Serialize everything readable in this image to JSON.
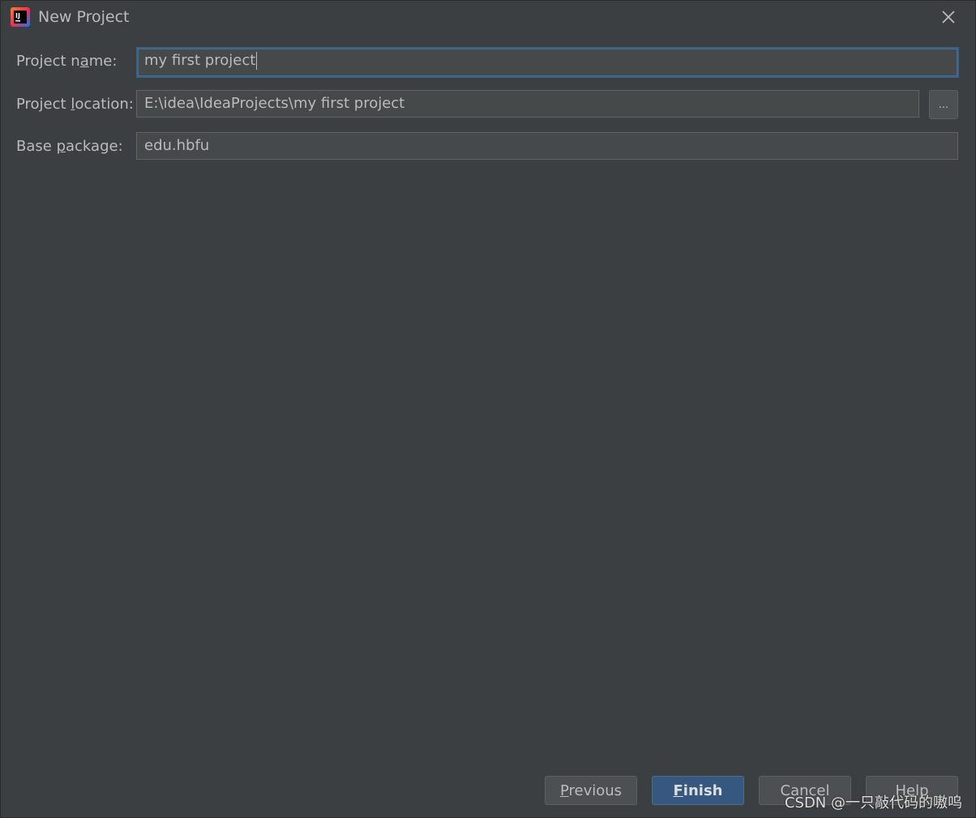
{
  "window": {
    "title": "New Project",
    "icon": "intellij-idea-icon",
    "close_icon": "close-icon"
  },
  "form": {
    "project_name": {
      "label_pre": "Project n",
      "label_mnemonic": "a",
      "label_post": "me:",
      "value": "my first project"
    },
    "project_location": {
      "label_pre": "Project ",
      "label_mnemonic": "l",
      "label_post": "ocation:",
      "value": "E:\\idea\\IdeaProjects\\my first project",
      "browse_label": "..."
    },
    "base_package": {
      "label_pre": "Base ",
      "label_mnemonic": "p",
      "label_post": "ackage:",
      "value": "edu.hbfu"
    }
  },
  "buttons": {
    "previous": {
      "mnemonic": "P",
      "rest": "revious"
    },
    "finish": {
      "mnemonic": "F",
      "rest": "inish"
    },
    "cancel": {
      "label": "Cancel"
    },
    "help": {
      "label": "Help"
    }
  },
  "watermark": "CSDN @一只敲代码的嗷呜",
  "colors": {
    "background": "#3c3f41",
    "field_background": "#45494a",
    "focus_border": "#3d6185",
    "primary_button": "#365880",
    "text": "#bbbbbb"
  }
}
